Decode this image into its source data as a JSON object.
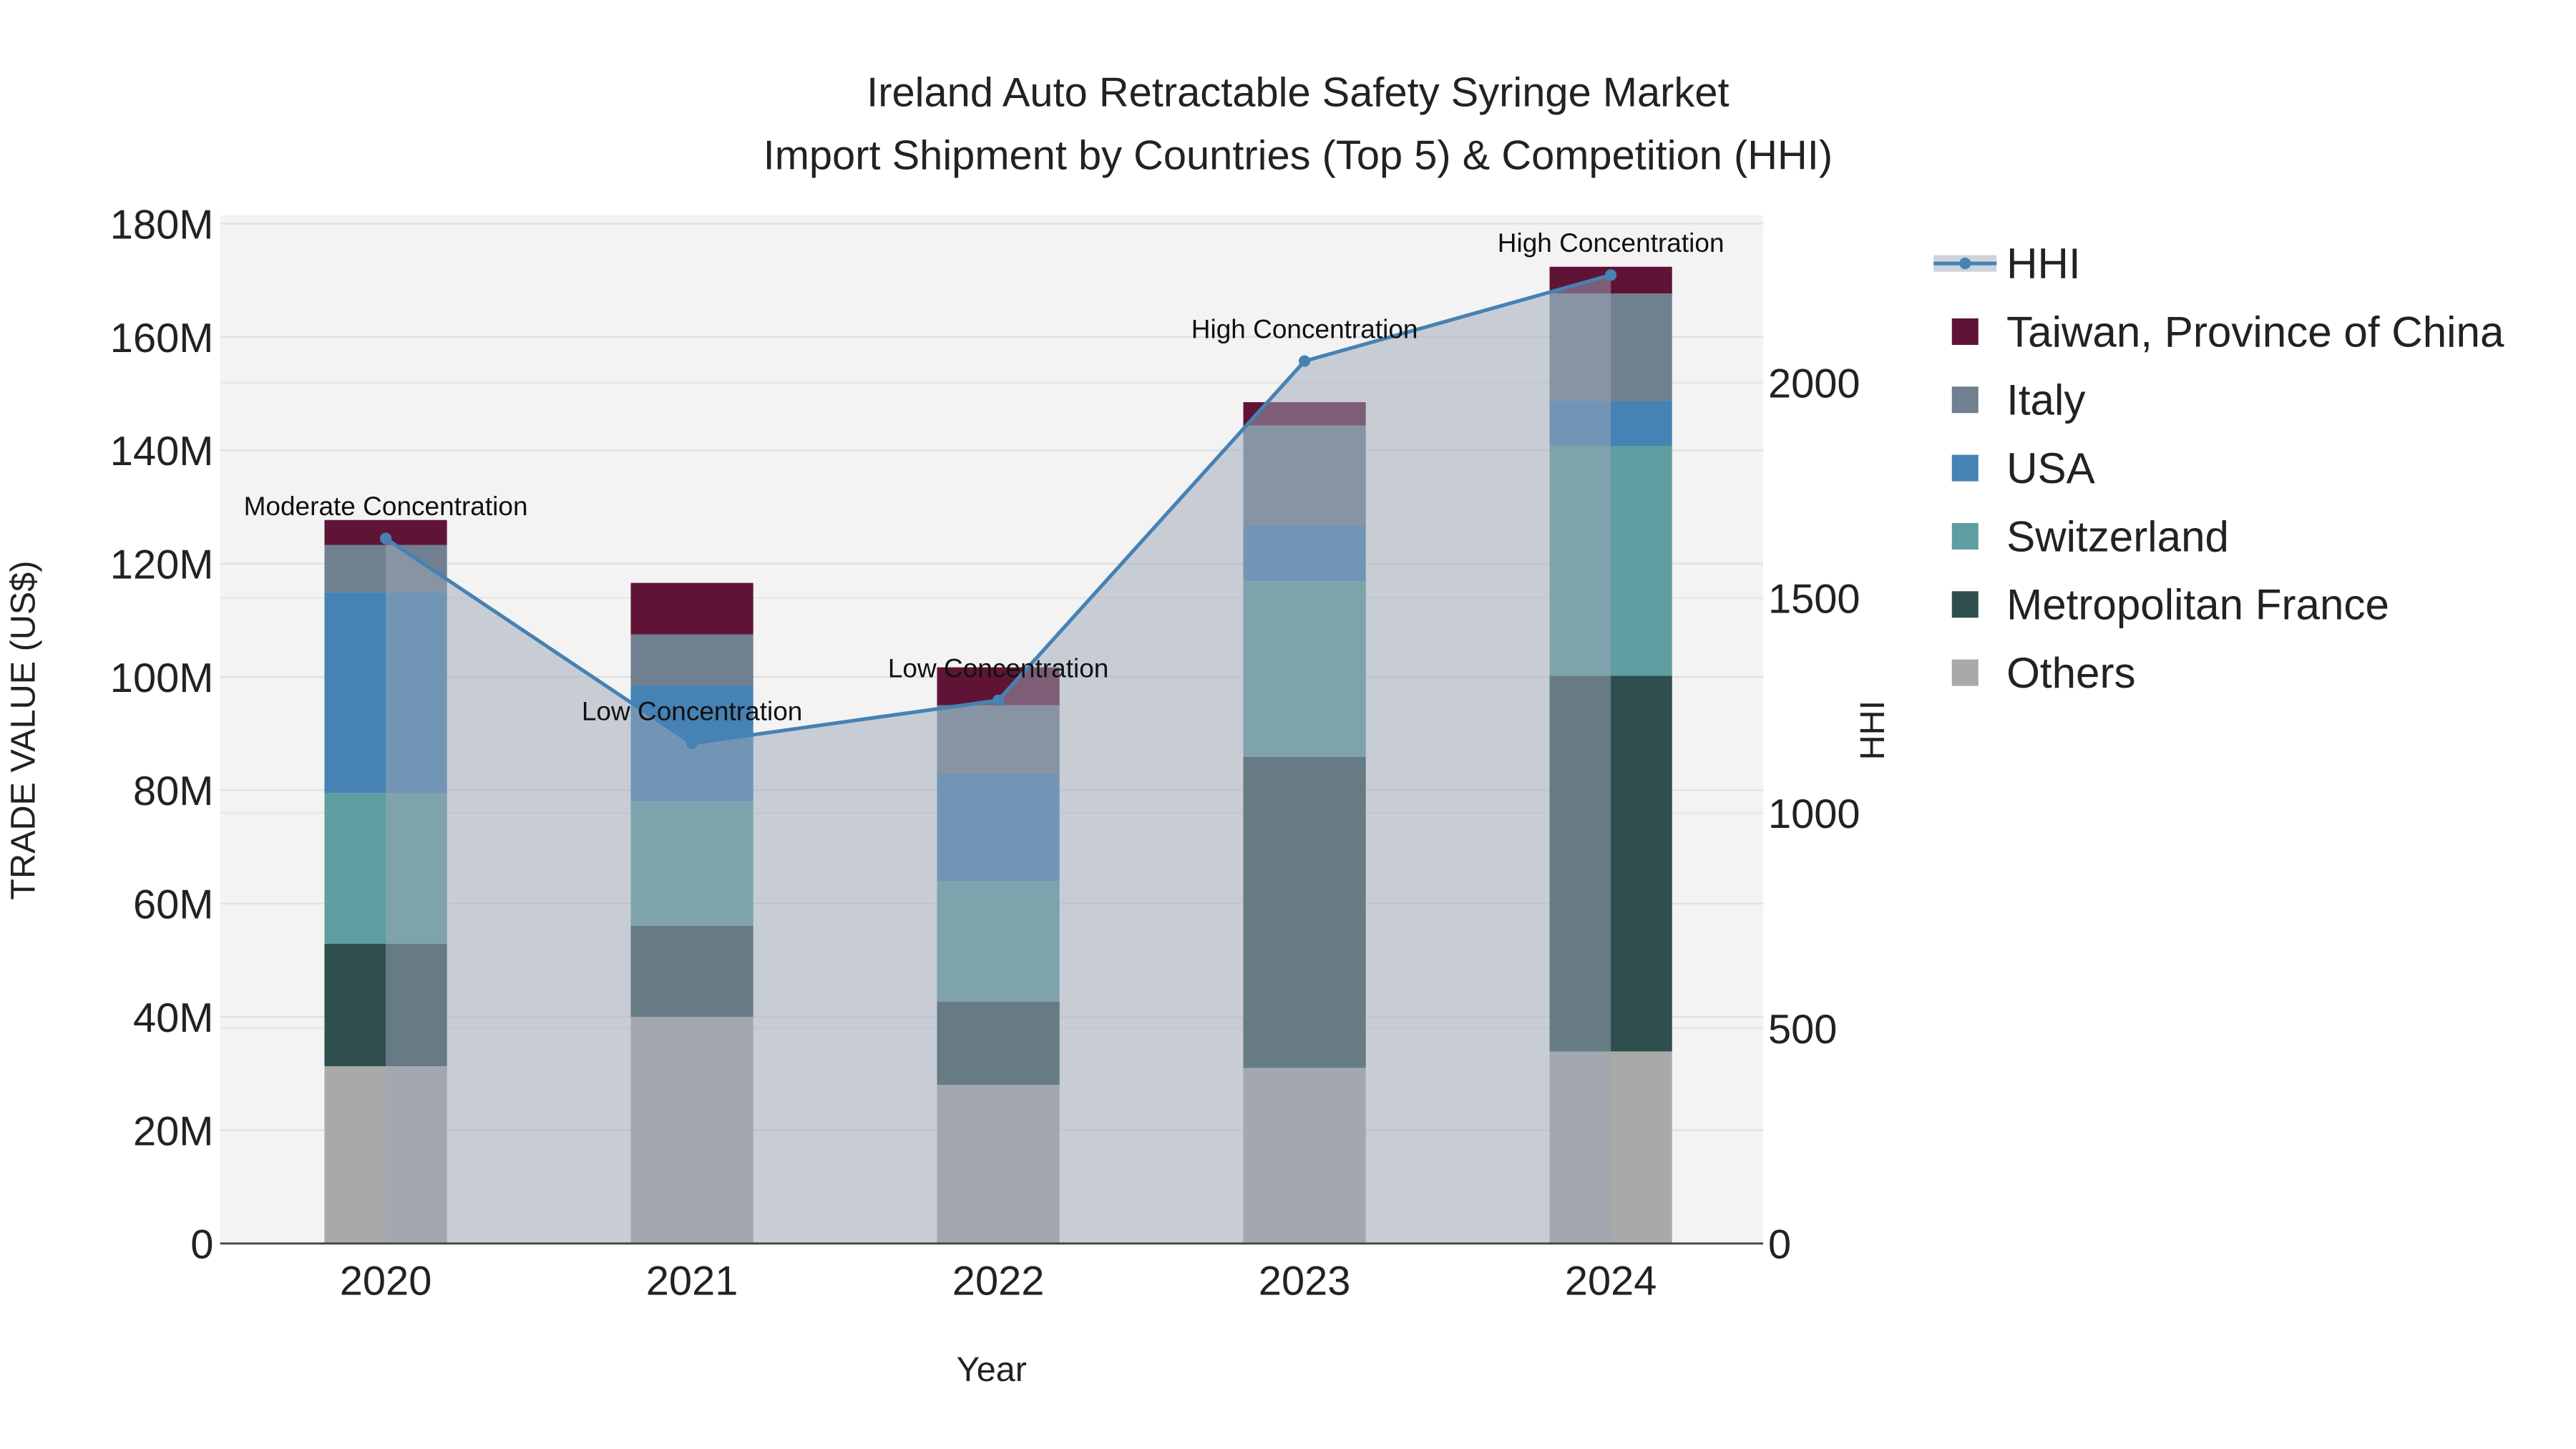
{
  "chart_data": {
    "type": "bar",
    "stacked": true,
    "title": "Ireland Auto Retractable Safety Syringe Market",
    "subtitle": "Import Shipment by Countries (Top 5) & Competition (HHI)",
    "xlabel": "Year",
    "ylabel": "TRADE VALUE (US$)",
    "y2label": "HHI",
    "categories": [
      "2020",
      "2021",
      "2022",
      "2023",
      "2024"
    ],
    "ylim": [
      0,
      180
    ],
    "y_unit": "M",
    "yticks": [
      "0",
      "20M",
      "40M",
      "60M",
      "80M",
      "100M",
      "120M",
      "140M",
      "160M",
      "180M"
    ],
    "y2lim": [
      0,
      2370
    ],
    "y2ticks": [
      "0",
      "500",
      "1000",
      "1500",
      "2000"
    ],
    "grid": true,
    "legend_position": "right",
    "series": [
      {
        "name": "Others",
        "color": "#a9a9a9",
        "values": [
          31.3,
          40.0,
          28.0,
          31.0,
          33.9
        ]
      },
      {
        "name": "Metropolitan France",
        "color": "#2f4f4f",
        "values": [
          21.6,
          16.1,
          14.7,
          54.9,
          66.3
        ]
      },
      {
        "name": "Switzerland",
        "color": "#5f9ea0",
        "values": [
          26.6,
          21.9,
          21.3,
          31.0,
          40.6
        ]
      },
      {
        "name": "USA",
        "color": "#4682b4",
        "values": [
          35.5,
          20.5,
          19.0,
          9.9,
          7.9
        ]
      },
      {
        "name": "Italy",
        "color": "#708090",
        "values": [
          8.3,
          9.0,
          12.0,
          17.6,
          19.0
        ]
      },
      {
        "name": "Taiwan, Province of China",
        "color": "#5f1436",
        "values": [
          4.4,
          9.1,
          6.7,
          4.1,
          4.7
        ]
      }
    ],
    "hhi": {
      "name": "HHI",
      "color": "#4682b4",
      "values": [
        1638,
        1162,
        1262,
        2050,
        2250
      ],
      "annotations": [
        "Moderate Concentration",
        "Low Concentration",
        "Low Concentration",
        "High Concentration",
        "High Concentration"
      ]
    },
    "legend_order": [
      "HHI",
      "Taiwan, Province of China",
      "Italy",
      "USA",
      "Switzerland",
      "Metropolitan France",
      "Others"
    ]
  }
}
